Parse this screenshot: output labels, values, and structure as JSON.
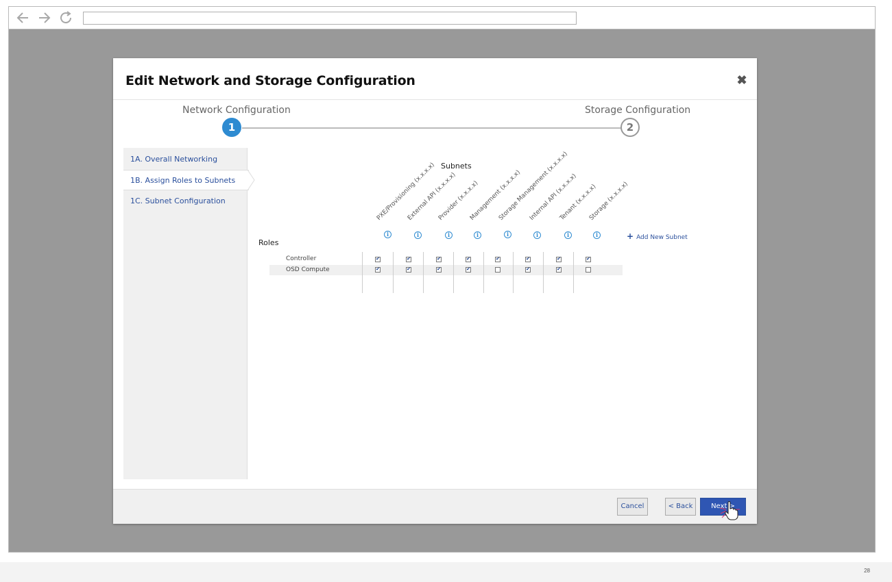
{
  "browser": {
    "back_icon": "arrow-left-icon",
    "forward_icon": "arrow-right-icon",
    "reload_icon": "reload-icon",
    "url": ""
  },
  "modal": {
    "title": "Edit Network and Storage Configuration",
    "close_icon": "close-icon",
    "steps": [
      {
        "label": "Network Configuration",
        "number": "1",
        "state": "active"
      },
      {
        "label": "Storage Configuration",
        "number": "2",
        "state": "inactive"
      }
    ],
    "sidebar": {
      "items": [
        {
          "label": "1A. Overall Networking",
          "active": false
        },
        {
          "label": "1B. Assign Roles to Subnets",
          "active": true
        },
        {
          "label": "1C. Subnet Configuration",
          "active": false
        }
      ]
    },
    "main": {
      "subnets_title": "Subnets",
      "roles_title": "Roles",
      "add_subnet_label": "Add New Subnet",
      "columns": [
        "PXE/Provisioning (x.x.x.x)",
        "External API (x.x.x.x)",
        "Provider (x.x.x.x)",
        "Management (x.x.x.x)",
        "Storage Management (x.x.x.x)",
        "Internal API (x.x.x.x)",
        "Tenant (x.x.x.x)",
        "Storage (x.x.x.x)"
      ],
      "rows": [
        {
          "role": "Controller",
          "checks": [
            true,
            true,
            true,
            true,
            true,
            true,
            true,
            true
          ]
        },
        {
          "role": "OSD Compute",
          "checks": [
            true,
            true,
            true,
            true,
            false,
            true,
            true,
            false
          ]
        }
      ]
    },
    "footer": {
      "cancel_label": "Cancel",
      "back_label": "< Back",
      "next_label": "Next >"
    }
  },
  "page_number": "28",
  "colors": {
    "accent": "#2e8bd1",
    "primary_button": "#2f56b3",
    "link": "#2a4f9c",
    "overlay": "#999999"
  }
}
